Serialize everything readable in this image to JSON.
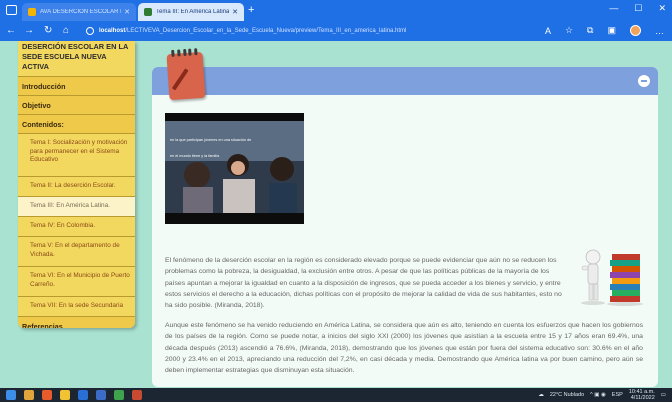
{
  "browser": {
    "tabs": [
      {
        "title": "AVA DESERCIÓN ESCOLAR EN",
        "active": false
      },
      {
        "title": "Tema III: En América Latina",
        "active": true
      }
    ],
    "url_host": "localhost",
    "url_path": "/LECTIVEVA_Desercion_Escolar_en_la_Sede_Escuela_Nueva/preview/Tema_III_en_america_latina.html",
    "icons": [
      "window-icon",
      "back-icon",
      "forward-icon",
      "reload-icon",
      "home-icon",
      "read-aloud-icon",
      "favorites-icon",
      "collections-icon",
      "profile-icon"
    ]
  },
  "sidebar": {
    "header": "DESERCIÓN ESCOLAR EN LA SEDE ESCUELA NUEVA ACTIVA",
    "items": [
      {
        "label": "Introducción",
        "type": "main"
      },
      {
        "label": "Objetivo",
        "type": "main"
      },
      {
        "label": "Contenidos:",
        "type": "main"
      },
      {
        "label": "Tema I: Socialización y motivación para permanecer en el Sistema Educativo",
        "type": "sub"
      },
      {
        "label": "Tema II: La deserción Escolar.",
        "type": "sub"
      },
      {
        "label": "Tema III: En América Latina.",
        "type": "sub",
        "active": true
      },
      {
        "label": "Tema IV: En Colombia.",
        "type": "sub"
      },
      {
        "label": "Tema V: En el departamento de Vichada.",
        "type": "sub"
      },
      {
        "label": "Tema VI: En el Municipio de Puerto Carreño.",
        "type": "sub"
      },
      {
        "label": "Tema VII: En la sede Secundaria",
        "type": "sub"
      },
      {
        "label": "Referencias",
        "type": "main"
      }
    ]
  },
  "content": {
    "video_caption_1": "en la que participan jóvenes en una situación de",
    "video_caption_2": "en el mundo tiene y la familia",
    "paragraph_1": "El fenómeno de la deserción escolar en la región es considerado elevado porque se puede evidenciar que aún no se reducen los problemas como la pobreza, la desigualdad, la exclusión entre otros. A pesar de que las políticas públicas de la mayoría de los países apuntan a mejorar la igualdad en cuanto a la disposición de ingresos, que se pueda acceder a los bienes y servicio, y entre estos servicios el derecho a la educación, dichas políticas con el propósito de mejorar la calidad de vida de sus habitantes, esto no ha sido posible. (Miranda, 2018).",
    "paragraph_2": "Aunque este fenómeno se ha venido reduciendo en América Latina, se considera que aún es alto, teniendo en cuenta los esfuerzos que hacen los gobiernos de los países de la región. Como se puede notar, a inicios del siglo XXI (2000) los jóvenes que asistían a la escuela entre 15 y 17 años eran 69.4%, una década después (2013) ascendió a 76.6%, (Miranda, 2018), demostrando que los jóvenes que están por fuera del sistema educativo son: 30.6% en el año 2000 y 23.4% en el 2013, apreciando una reducción del 7,2%, en casi década y media. Demostrando que América latina va por buen camino, pero aún se deben implementar estrategias que disminuyan esta situación."
  },
  "taskbar": {
    "weather": "22°C Nublado",
    "lang": "ESP",
    "time": "10:41 a.m.",
    "date": "4/11/2022"
  },
  "colors": {
    "browser_blue": "#1f6fe5",
    "sidebar_yellow": "#f3d860",
    "card_header_blue": "#7ea0dd",
    "page_background": "#a9e2d0"
  }
}
